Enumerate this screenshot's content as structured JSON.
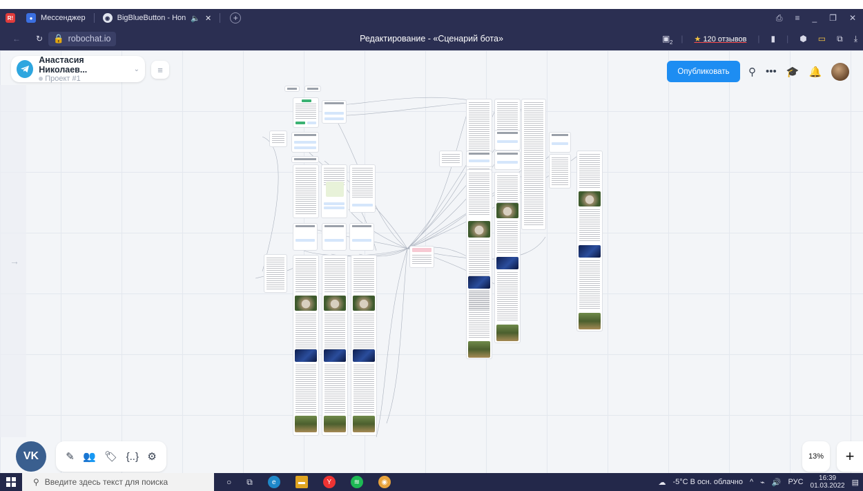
{
  "browser": {
    "tabs": [
      {
        "label": "Мессенджер",
        "active": false
      },
      {
        "label": "BigBlueButton - Hon",
        "active": true
      }
    ],
    "url": "robochat.io",
    "page_title": "Редактирование - «Сценарий бота»",
    "reviews": "120 отзывов",
    "extensions_badge": "2"
  },
  "project": {
    "name": "Анастасия Николаев...",
    "sub": "Проект #1"
  },
  "toolbar": {
    "publish_label": "Опубликовать"
  },
  "bottom": {
    "vk_label": "VK",
    "zoom": "13%",
    "add_label": "+"
  },
  "taskbar": {
    "search_placeholder": "Введите здесь текст для поиска",
    "weather": "-5°C В осн. облачно",
    "lang": "РУС",
    "time": "16:39",
    "date": "01.03.2022"
  },
  "colors": {
    "accent": "#1d8df2",
    "browser_bg": "#2b2f52",
    "telegram": "#2ea6df",
    "vk": "#3a5f8f"
  }
}
